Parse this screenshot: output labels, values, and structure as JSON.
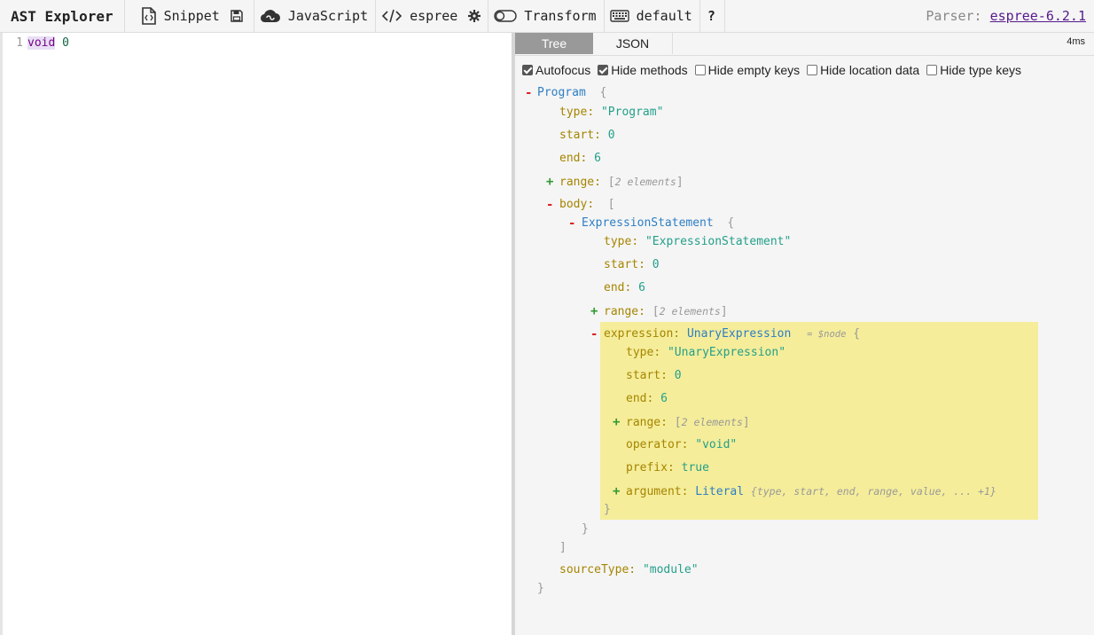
{
  "toolbar": {
    "title": "AST Explorer",
    "snippet_label": "Snippet",
    "language_label": "JavaScript",
    "parser_name": "espree",
    "transform_label": "Transform",
    "keymap_label": "default",
    "help_label": "?",
    "parser_prefix": "Parser:",
    "parser_version": "espree-6.2.1"
  },
  "editor": {
    "line_number": "1",
    "keyword": "void",
    "number": "0"
  },
  "output": {
    "tabs": {
      "tree": "Tree",
      "json": "JSON"
    },
    "timing": "4ms",
    "options": [
      {
        "label": "Autofocus",
        "checked": true
      },
      {
        "label": "Hide methods",
        "checked": true
      },
      {
        "label": "Hide empty keys",
        "checked": false
      },
      {
        "label": "Hide location data",
        "checked": false
      },
      {
        "label": "Hide type keys",
        "checked": false
      }
    ]
  },
  "tree": {
    "program": "Program",
    "program_type_val": "\"Program\"",
    "program_start": "0",
    "program_end": "6",
    "range_meta": "2 elements",
    "expr_stmt": "ExpressionStatement",
    "expr_stmt_type_val": "\"ExpressionStatement\"",
    "expr_stmt_start": "0",
    "expr_stmt_end": "6",
    "unary": "UnaryExpression",
    "node_annotation": "= $node",
    "unary_type_val": "\"UnaryExpression\"",
    "unary_start": "0",
    "unary_end": "6",
    "operator_val": "\"void\"",
    "prefix_val": "true",
    "literal": "Literal",
    "literal_meta": "{type, start, end, range, value, ... +1}",
    "source_type_val": "\"module\"",
    "keys": {
      "type": "type",
      "start": "start",
      "end": "end",
      "range": "range",
      "body": "body",
      "expression": "expression",
      "operator": "operator",
      "prefix": "prefix",
      "argument": "argument",
      "sourceType": "sourceType"
    }
  }
}
